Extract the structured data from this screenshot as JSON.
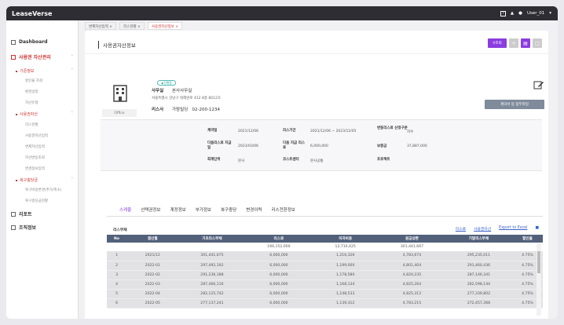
{
  "app": {
    "title": "LeaseVerse"
  },
  "topbar": {
    "user": "User_01"
  },
  "sidebar": {
    "dashboard": "Dashboard",
    "asset_mgmt": "사용권 자산관리",
    "base_info": "기준정보",
    "base_items": [
      "할인율 조회",
      "환경설정",
      "자산유형"
    ],
    "right_of_use": "사용권자산",
    "rou_items": [
      "리스현황",
      "사용권자산입력",
      "변제자산입력",
      "자산변동조회",
      "변경정보입력"
    ],
    "restore": "복구충당금",
    "restore_items": [
      "복구비용변경(추가/축소)",
      "복구충당금현황"
    ],
    "report": "리포트",
    "org": "조직정보"
  },
  "tabs": [
    "변제자산입력",
    "리스현황",
    "사용권자산정보"
  ],
  "page": {
    "title": "사용권자산정보",
    "search_btn": "조회",
    "status_badge": "진행중",
    "asset_type": "Office",
    "name_label": "사무실",
    "name_value": "본사사무실",
    "address": "서울특별시 강남구 테헤란로 412 8층 8012호",
    "lessor_label": "리스사",
    "lessor_value": "가람빌딩",
    "lessor_tel": "02-200-1234",
    "report_btn": "계약서 등 첨부파일"
  },
  "info": {
    "contract_date_l": "계약일",
    "contract_date_v": "2021/12/06",
    "period_l": "리스기간",
    "period_v": "2021/12/06 ~ 2023/12/05",
    "option_l": "변동리스료 산정구분",
    "option_v": "지수",
    "next_pay_l": "다음리스료 지급일",
    "next_pay_v": "2023/03/06",
    "next_lease_l": "다음 지급 리스료",
    "next_lease_v": "6,000,000",
    "deposit_l": "보증금",
    "deposit_v": "37,887,000",
    "currency_l": "회계단위",
    "currency_v": "본사",
    "cost_l": "코스트센터",
    "cost_v": "본사공통",
    "project_l": "프로젝트",
    "project_v": ""
  },
  "detail_tabs": [
    "스케쥴",
    "선택권정보",
    "계정정보",
    "부가정보",
    "복구충당",
    "변경이력",
    "리스전환정보"
  ],
  "table": {
    "label": "리스부채",
    "links": [
      "리스료",
      "사용권자산",
      "Export to Excel"
    ],
    "headers": [
      "No",
      "결산월",
      "기초리스부채",
      "리스료",
      "이자비용",
      "원금상환",
      "기말리스부채",
      "할인율"
    ],
    "summary": [
      "",
      "",
      "",
      "166,152,000",
      "12,710,425",
      "301,441,667",
      "",
      ""
    ],
    "rows": [
      [
        "1",
        "2021/12",
        "301,441,675",
        "6,000,000",
        "1,216,326",
        "4,783,674",
        "295,235,011",
        "4.75%"
      ],
      [
        "2",
        "2022-01",
        "297,492,192",
        "6,000,000",
        "1,199,000",
        "4,801,404",
        "291,460,436",
        "4.75%"
      ],
      [
        "3",
        "2022-02",
        "291,236,188",
        "6,000,000",
        "1,178,580",
        "4,820,235",
        "287,146,341",
        "4.75%"
      ],
      [
        "4",
        "2022-03",
        "287,466,116",
        "6,000,000",
        "1,168,134",
        "4,825,264",
        "282,598,144",
        "4.75%"
      ],
      [
        "5",
        "2022-04",
        "282,125,742",
        "6,000,000",
        "1,148,533",
        "4,825,312",
        "277,339,802",
        "4.75%"
      ],
      [
        "6",
        "2022-05",
        "277,137,241",
        "6,000,000",
        "1,139,312",
        "4,783,215",
        "272,457,368",
        "4.75%"
      ]
    ]
  },
  "colors": {
    "accent": "#8b3de0",
    "header": "#52607a",
    "red": "#cc3333",
    "topbar": "#2d2d33"
  }
}
